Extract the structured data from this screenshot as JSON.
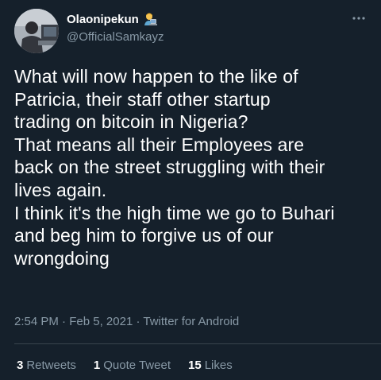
{
  "author": {
    "display_name": "Olaonipekun",
    "badge_emoji_icon": "technologist-emoji-icon",
    "handle": "@OfficialSamkayz"
  },
  "tweet": {
    "lines": [
      "What will now happen to the like of",
      "Patricia, their staff other startup",
      "trading on bitcoin in Nigeria?",
      "That means all their Employees are",
      "back on the street struggling with their",
      "lives again.",
      "I think it's the high time we go to Buhari",
      "and beg him to forgive us of our",
      "wrongdoing"
    ]
  },
  "meta": {
    "time": "2:54 PM",
    "separator": "·",
    "date": "Feb 5, 2021",
    "source": "Twitter for Android"
  },
  "stats": {
    "retweets_count": "3",
    "retweets_label": "Retweets",
    "quotes_count": "1",
    "quotes_label": "Quote Tweet",
    "likes_count": "15",
    "likes_label": "Likes"
  },
  "colors": {
    "background": "#15202b",
    "text_primary": "#ffffff",
    "text_secondary": "#8899a6",
    "divider": "#38444d"
  }
}
